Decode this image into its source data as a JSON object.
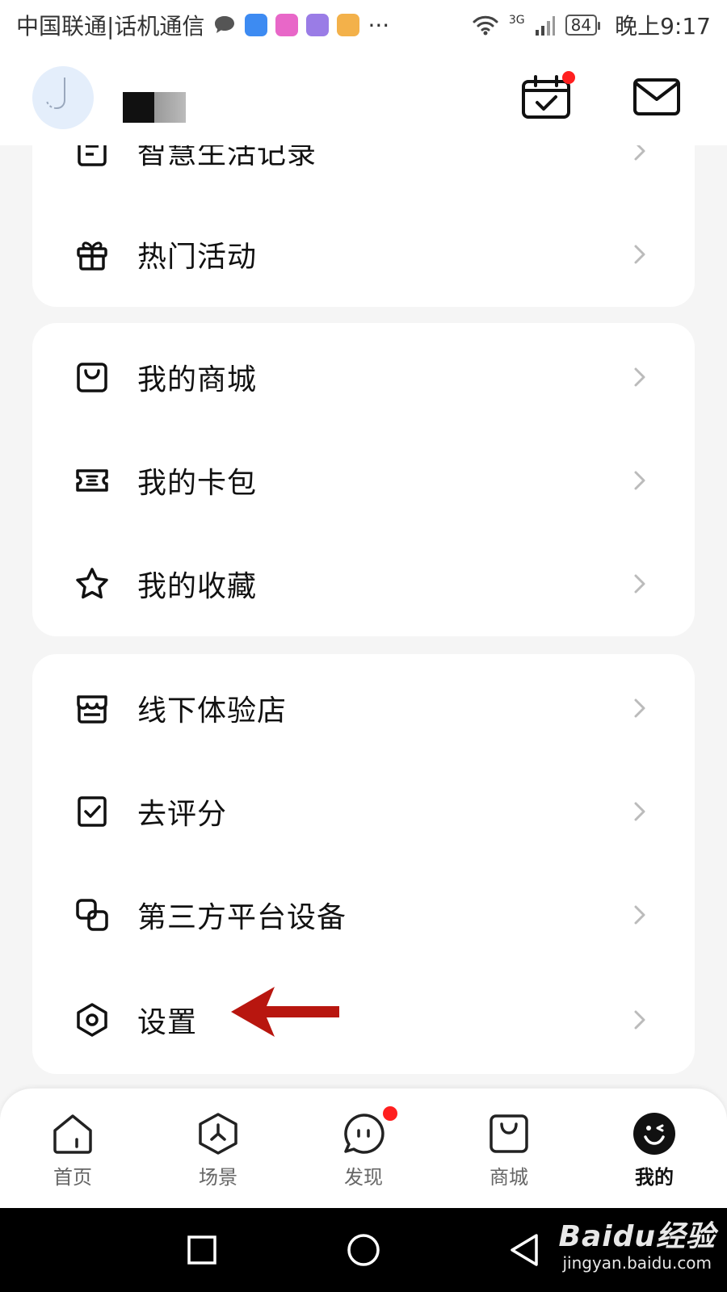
{
  "status_bar": {
    "carrier": "中国联通|话机通信",
    "more": "···",
    "network": "3G",
    "battery": "84",
    "time": "晚上9:17"
  },
  "header": {
    "avatar_icon": "user-avatar",
    "calendar_icon": "calendar-check-icon",
    "mail_icon": "mail-icon",
    "notification_color": "#ff1f1f"
  },
  "menu": {
    "group1": [
      {
        "label": "智慧生活记录",
        "icon": "record-icon"
      },
      {
        "label": "热门活动",
        "icon": "gift-icon"
      }
    ],
    "group2": [
      {
        "label": "我的商城",
        "icon": "shopping-bag-icon"
      },
      {
        "label": "我的卡包",
        "icon": "ticket-icon"
      },
      {
        "label": "我的收藏",
        "icon": "star-icon"
      }
    ],
    "group3": [
      {
        "label": "线下体验店",
        "icon": "store-icon"
      },
      {
        "label": "去评分",
        "icon": "check-square-icon"
      },
      {
        "label": "第三方平台设备",
        "icon": "link-devices-icon"
      },
      {
        "label": "设置",
        "icon": "settings-icon"
      }
    ]
  },
  "annotation": {
    "arrow_color": "#b8160f",
    "target": "设置"
  },
  "bottom_nav": [
    {
      "label": "首页",
      "icon": "home-icon"
    },
    {
      "label": "场景",
      "icon": "scene-icon"
    },
    {
      "label": "发现",
      "icon": "discover-icon"
    },
    {
      "label": "商城",
      "icon": "mall-icon"
    },
    {
      "label": "我的",
      "icon": "profile-icon",
      "active": true
    }
  ],
  "watermark": {
    "brand": "Baidu经验",
    "url": "jingyan.baidu.com"
  }
}
